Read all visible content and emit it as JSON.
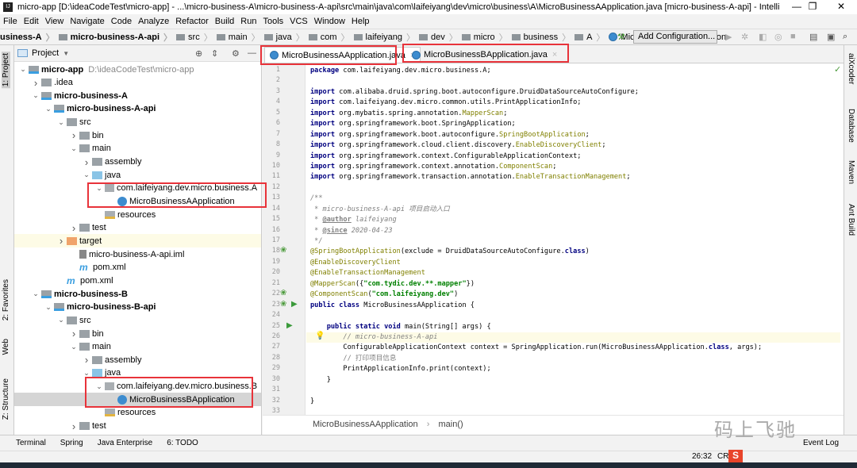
{
  "window": {
    "title": "micro-app [D:\\ideaCodeTest\\micro-app] - ...\\micro-business-A\\micro-business-A-api\\src\\main\\java\\com\\laifeiyang\\dev\\micro\\business\\A\\MicroBusinessAApplication.java [micro-business-A-api] - IntelliJ ID...",
    "app_icon": "IJ",
    "minimize": "—",
    "restore": "❐",
    "close": "✕"
  },
  "menu": [
    "File",
    "Edit",
    "View",
    "Navigate",
    "Code",
    "Analyze",
    "Refactor",
    "Build",
    "Run",
    "Tools",
    "VCS",
    "Window",
    "Help"
  ],
  "navbar": {
    "crumbs": [
      "usiness-A",
      "micro-business-A-api",
      "src",
      "main",
      "java",
      "com",
      "laifeiyang",
      "dev",
      "micro",
      "business",
      "A",
      "MicroBusinessAApplication"
    ],
    "add_configuration": "Add Configuration..."
  },
  "left_tool_tabs": [
    "1: Project",
    "2: Favorites",
    "Web",
    "Z: Structure"
  ],
  "project": {
    "header": "Project",
    "tree": [
      {
        "label": "micro-app",
        "depth": 0,
        "arrow": "v",
        "icon": "module",
        "bold": true,
        "path": "D:\\ideaCodeTest\\micro-app"
      },
      {
        "label": ".idea",
        "depth": 1,
        "arrow": ">",
        "icon": "folder"
      },
      {
        "label": "micro-business-A",
        "depth": 1,
        "arrow": "v",
        "icon": "module",
        "bold": true
      },
      {
        "label": "micro-business-A-api",
        "depth": 2,
        "arrow": "v",
        "icon": "module",
        "bold": true
      },
      {
        "label": "src",
        "depth": 3,
        "arrow": "v",
        "icon": "folder"
      },
      {
        "label": "bin",
        "depth": 4,
        "arrow": ">",
        "icon": "folder"
      },
      {
        "label": "main",
        "depth": 4,
        "arrow": "v",
        "icon": "folder"
      },
      {
        "label": "assembly",
        "depth": 5,
        "arrow": ">",
        "icon": "folder"
      },
      {
        "label": "java",
        "depth": 5,
        "arrow": "v",
        "icon": "src"
      },
      {
        "label": "com.laifeiyang.dev.micro.business.A",
        "depth": 6,
        "arrow": "v",
        "icon": "pkg"
      },
      {
        "label": "MicroBusinessAApplication",
        "depth": 7,
        "arrow": "",
        "icon": "cls"
      },
      {
        "label": "resources",
        "depth": 6,
        "arrow": "",
        "icon": "res"
      },
      {
        "label": "test",
        "depth": 4,
        "arrow": ">",
        "icon": "folder"
      },
      {
        "label": "target",
        "depth": 3,
        "arrow": ">",
        "icon": "target",
        "yellow": true
      },
      {
        "label": "micro-business-A-api.iml",
        "depth": 4,
        "arrow": "",
        "icon": "iml"
      },
      {
        "label": "pom.xml",
        "depth": 4,
        "arrow": "",
        "icon": "maven"
      },
      {
        "label": "pom.xml",
        "depth": 3,
        "arrow": "",
        "icon": "maven"
      },
      {
        "label": "micro-business-B",
        "depth": 1,
        "arrow": "v",
        "icon": "module",
        "bold": true
      },
      {
        "label": "micro-business-B-api",
        "depth": 2,
        "arrow": "v",
        "icon": "module",
        "bold": true
      },
      {
        "label": "src",
        "depth": 3,
        "arrow": "v",
        "icon": "folder"
      },
      {
        "label": "bin",
        "depth": 4,
        "arrow": ">",
        "icon": "folder"
      },
      {
        "label": "main",
        "depth": 4,
        "arrow": "v",
        "icon": "folder"
      },
      {
        "label": "assembly",
        "depth": 5,
        "arrow": ">",
        "icon": "folder"
      },
      {
        "label": "java",
        "depth": 5,
        "arrow": "v",
        "icon": "src"
      },
      {
        "label": "com.laifeiyang.dev.micro.business.B",
        "depth": 6,
        "arrow": "v",
        "icon": "pkg"
      },
      {
        "label": "MicroBusinessBApplication",
        "depth": 7,
        "arrow": "",
        "icon": "cls",
        "selected": true
      },
      {
        "label": "resources",
        "depth": 6,
        "arrow": "",
        "icon": "res"
      },
      {
        "label": "test",
        "depth": 4,
        "arrow": ">",
        "icon": "folder"
      }
    ]
  },
  "editor": {
    "tabs": [
      {
        "label": "MicroBusinessAApplication.java",
        "active": true
      },
      {
        "label": "MicroBusinessBApplication.java",
        "active": false
      }
    ],
    "current_line": 26,
    "lines": [
      [
        [
          "package",
          "kw"
        ],
        [
          " com.laifeiyang.dev.micro.business.A;",
          "pl"
        ]
      ],
      [],
      [
        [
          "import",
          "kw"
        ],
        [
          " com.alibaba.druid.spring.boot.autoconfigure.DruidDataSourceAutoConfigure;",
          "pl"
        ]
      ],
      [
        [
          "import",
          "kw"
        ],
        [
          " com.laifeiyang.dev.micro.common.utils.PrintApplicationInfo;",
          "pl"
        ]
      ],
      [
        [
          "import",
          "kw"
        ],
        [
          " org.mybatis.spring.annotation.",
          "pl"
        ],
        [
          "MapperScan",
          "ann"
        ],
        [
          ";",
          "pl"
        ]
      ],
      [
        [
          "import",
          "kw"
        ],
        [
          " org.springframework.boot.SpringApplication;",
          "pl"
        ]
      ],
      [
        [
          "import",
          "kw"
        ],
        [
          " org.springframework.boot.autoconfigure.",
          "pl"
        ],
        [
          "SpringBootApplication",
          "ann"
        ],
        [
          ";",
          "pl"
        ]
      ],
      [
        [
          "import",
          "kw"
        ],
        [
          " org.springframework.cloud.client.discovery.",
          "pl"
        ],
        [
          "EnableDiscoveryClient",
          "ann"
        ],
        [
          ";",
          "pl"
        ]
      ],
      [
        [
          "import",
          "kw"
        ],
        [
          " org.springframework.context.ConfigurableApplicationContext;",
          "pl"
        ]
      ],
      [
        [
          "import",
          "kw"
        ],
        [
          " org.springframework.context.annotation.",
          "pl"
        ],
        [
          "ComponentScan",
          "ann"
        ],
        [
          ";",
          "pl"
        ]
      ],
      [
        [
          "import",
          "kw"
        ],
        [
          " org.springframework.transaction.annotation.",
          "pl"
        ],
        [
          "EnableTransactionManagement",
          "ann"
        ],
        [
          ";",
          "pl"
        ]
      ],
      [],
      [
        [
          "/**",
          "cmt"
        ]
      ],
      [
        [
          " * micro-business-A-api 项目启动入口",
          "cmt"
        ]
      ],
      [
        [
          " * ",
          "cmt"
        ],
        [
          "@author",
          "tag"
        ],
        [
          " laifeiyang",
          "cmt"
        ]
      ],
      [
        [
          " * ",
          "cmt"
        ],
        [
          "@since",
          "tag"
        ],
        [
          " 2020-04-23",
          "cmt"
        ]
      ],
      [
        [
          " */",
          "cmt"
        ]
      ],
      [
        [
          "@SpringBootApplication",
          "ann"
        ],
        [
          "(exclude = DruidDataSourceAutoConfigure.",
          "pl"
        ],
        [
          "class",
          "kw"
        ],
        [
          ")",
          "pl"
        ]
      ],
      [
        [
          "@EnableDiscoveryClient",
          "ann"
        ]
      ],
      [
        [
          "@EnableTransactionManagement",
          "ann"
        ]
      ],
      [
        [
          "@MapperScan",
          "ann"
        ],
        [
          "({",
          "pl"
        ],
        [
          "\"com.tydic.dev.**.mapper\"",
          "str"
        ],
        [
          "})",
          "pl"
        ]
      ],
      [
        [
          "@ComponentScan",
          "ann"
        ],
        [
          "(",
          "pl"
        ],
        [
          "\"com.laifeiyang.dev\"",
          "str"
        ],
        [
          ")",
          "pl"
        ]
      ],
      [
        [
          "public class",
          "kw"
        ],
        [
          " MicroBusinessAApplication {",
          "pl"
        ]
      ],
      [],
      [
        [
          "    public static void",
          "kw"
        ],
        [
          " main(String[] args) {",
          "pl"
        ]
      ],
      [
        [
          "        // micro-business-A-api",
          "cmt"
        ]
      ],
      [
        [
          "        ConfigurableApplicationContext context = SpringApplication.run(MicroBusinessAApplication.",
          "pl"
        ],
        [
          "class",
          "kw"
        ],
        [
          ", args);",
          "pl"
        ]
      ],
      [
        [
          "        // 打印项目信息",
          "cmtn"
        ]
      ],
      [
        [
          "        PrintApplicationInfo.print(context);",
          "pl"
        ]
      ],
      [
        [
          "    }",
          "pl"
        ]
      ],
      [],
      [
        [
          "}",
          "pl"
        ]
      ],
      []
    ],
    "breadcrumb": [
      "MicroBusinessAApplication",
      "main()"
    ]
  },
  "right_tool_tabs": [
    "aiXcoder",
    "Database",
    "Maven",
    "Ant Build"
  ],
  "bottom_tools": [
    "Terminal",
    "Spring",
    "Java Enterprise",
    "6: TODO"
  ],
  "status": {
    "position": "26:32",
    "line_sep": "CRLF",
    "event_log": "Event Log"
  },
  "watermark": "码上飞驰",
  "colors": {
    "highlight_box": "#e8333a",
    "keyword": "#000080",
    "annotation": "#808000",
    "string": "#008000",
    "comment": "#808080"
  }
}
